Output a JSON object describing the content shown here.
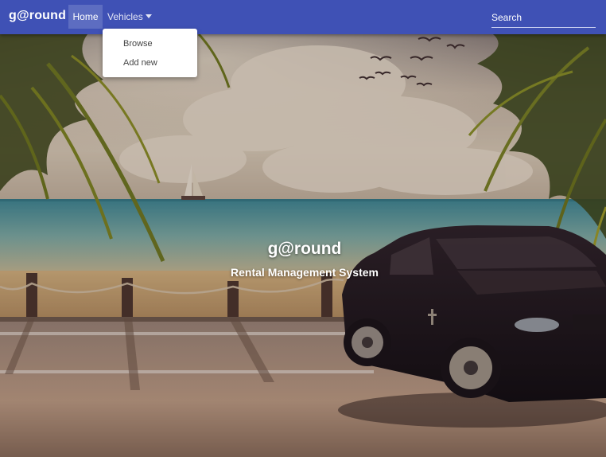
{
  "navbar": {
    "brand": "g@round",
    "home_label": "Home",
    "vehicles_label": "Vehicles",
    "search_placeholder": "Search"
  },
  "vehicles_menu": {
    "items": [
      "Browse",
      "Add new"
    ]
  },
  "hero": {
    "title": "g@round",
    "subtitle": "Rental Management System"
  },
  "colors": {
    "navbar": "#3f51b5",
    "active_tab": "#5c6cc4",
    "dropdown_bg": "#ffffff"
  },
  "icons": {
    "vehicles_caret": "chevron-down-icon"
  }
}
